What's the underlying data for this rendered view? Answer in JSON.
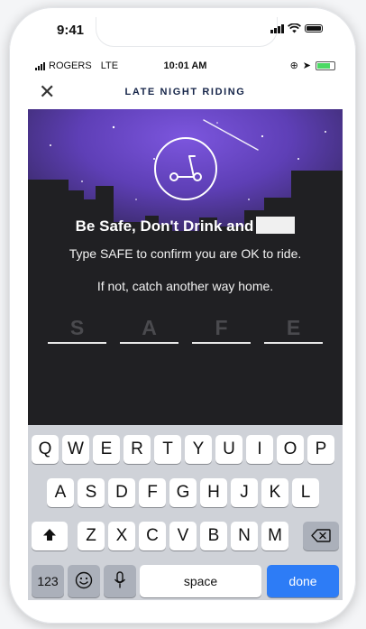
{
  "device": {
    "time": "9:41"
  },
  "status_bar": {
    "carrier": "ROGERS",
    "network": "LTE",
    "time": "10:01 AM"
  },
  "nav": {
    "title": "LATE NIGHT RIDING",
    "close_glyph": "✕"
  },
  "hero": {
    "headline": "Be Safe, Don't Drink and",
    "instruction": "Type SAFE to confirm you are OK to ride.",
    "alternative": "If not, catch another way home.",
    "placeholder_letters": [
      "S",
      "A",
      "F",
      "E"
    ],
    "icon": "scooter-icon",
    "accent_color": "#7b54d8"
  },
  "keyboard": {
    "row1": [
      "Q",
      "W",
      "E",
      "R",
      "T",
      "Y",
      "U",
      "I",
      "O",
      "P"
    ],
    "row2": [
      "A",
      "S",
      "D",
      "F",
      "G",
      "H",
      "J",
      "K",
      "L"
    ],
    "row3": [
      "Z",
      "X",
      "C",
      "V",
      "B",
      "N",
      "M"
    ],
    "numbers_label": "123",
    "space_label": "space",
    "done_label": "done",
    "done_color": "#2d7cf6"
  }
}
